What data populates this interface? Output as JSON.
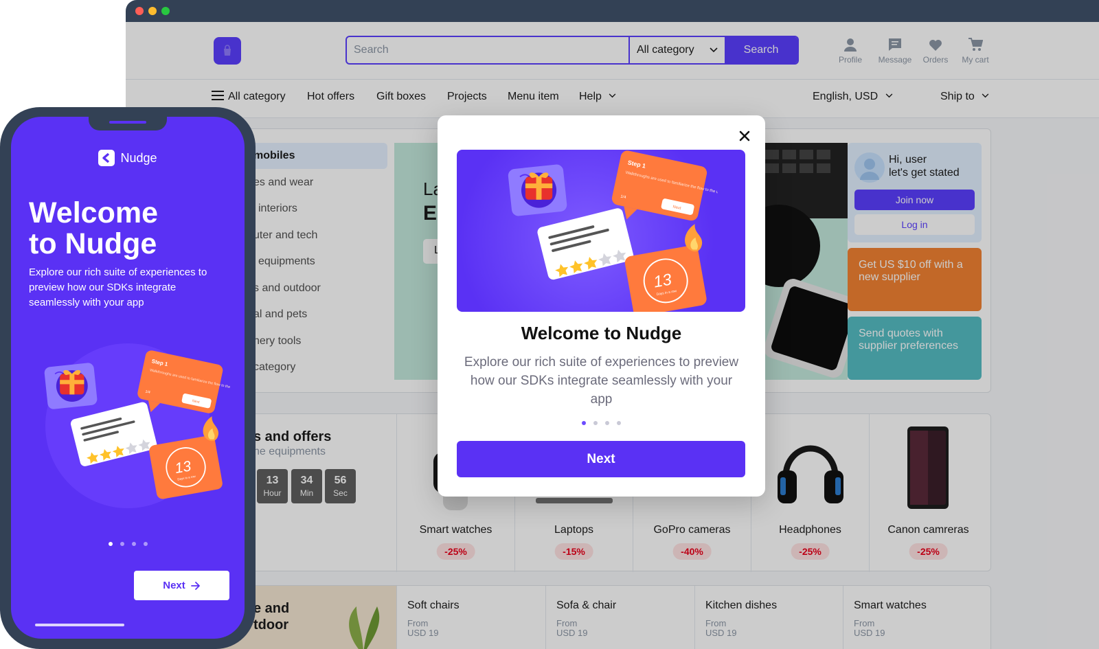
{
  "colors": {
    "accent": "#5a31f4",
    "site_accent": "#5a3fff",
    "frame": "#334155",
    "promo_orange": "#f38332",
    "promo_teal": "#55bdc3",
    "discount": "#eb001b"
  },
  "site": {
    "search": {
      "placeholder": "Search",
      "category": "All category",
      "button": "Search"
    },
    "header_actions": [
      {
        "label": "Profile",
        "icon": "person-icon"
      },
      {
        "label": "Message",
        "icon": "message-icon"
      },
      {
        "label": "Orders",
        "icon": "heart-icon"
      },
      {
        "label": "My cart",
        "icon": "cart-icon"
      }
    ],
    "nav": {
      "all_category": "All category",
      "items": [
        "Hot offers",
        "Gift boxes",
        "Projects",
        "Menu item",
        "Help"
      ],
      "language": "English, USD",
      "ship_to": "Ship to"
    },
    "categories": [
      "mobiles",
      "es and wear",
      "interiors",
      "uter and tech",
      "equipments",
      "s and outdoor",
      "al and pets",
      "nery tools",
      "category"
    ],
    "banner": {
      "line1": "La",
      "line2": "El",
      "button": "L"
    },
    "user_card": {
      "greeting": "Hi, user",
      "subtitle": "let's get stated",
      "join": "Join now",
      "login": "Log in"
    },
    "promo_orange": "Get US $10 off with a new supplier",
    "promo_teal": "Send quotes with supplier preferences",
    "deals": {
      "title": "s and offers",
      "subtitle": "ne equipments",
      "countdown": [
        {
          "num": "13",
          "label": "Hour"
        },
        {
          "num": "34",
          "label": "Min"
        },
        {
          "num": "56",
          "label": "Sec"
        }
      ],
      "items": [
        {
          "name": "Smart watches",
          "discount": "-25%"
        },
        {
          "name": "Laptops",
          "discount": "-15%"
        },
        {
          "name": "GoPro cameras",
          "discount": "-40%"
        },
        {
          "name": "Headphones",
          "discount": "-25%"
        },
        {
          "name": "Canon camreras",
          "discount": "-25%"
        }
      ]
    },
    "home": {
      "title_line1": "e and",
      "title_line2": "tdoor",
      "items": [
        {
          "name": "Soft chairs",
          "from": "From",
          "price": "USD 19"
        },
        {
          "name": "Sofa & chair",
          "from": "From",
          "price": "USD 19"
        },
        {
          "name": "Kitchen dishes",
          "from": "From",
          "price": "USD 19"
        },
        {
          "name": "Smart watches",
          "from": "From",
          "price": "USD 19"
        }
      ]
    }
  },
  "modal": {
    "title": "Welcome to Nudge",
    "description": "Explore our rich suite of experiences to preview how our SDKs integrate seamlessly with your app",
    "button": "Next",
    "total_steps": 4,
    "current_step": 1
  },
  "phone": {
    "brand": "Nudge",
    "title_line1": "Welcome",
    "title_line2": "to Nudge",
    "description": "Explore our rich suite of experiences to preview how our SDKs integrate seamlessly with your app",
    "button": "Next",
    "total_steps": 4,
    "current_step": 1
  },
  "illustration": {
    "step_label": "Step 1",
    "step_text": "Walkthroughs are used to familiarize the flow to the user",
    "count": "1/4",
    "next": "Next",
    "streak_num": "13",
    "streak_text": "Days in a row"
  }
}
